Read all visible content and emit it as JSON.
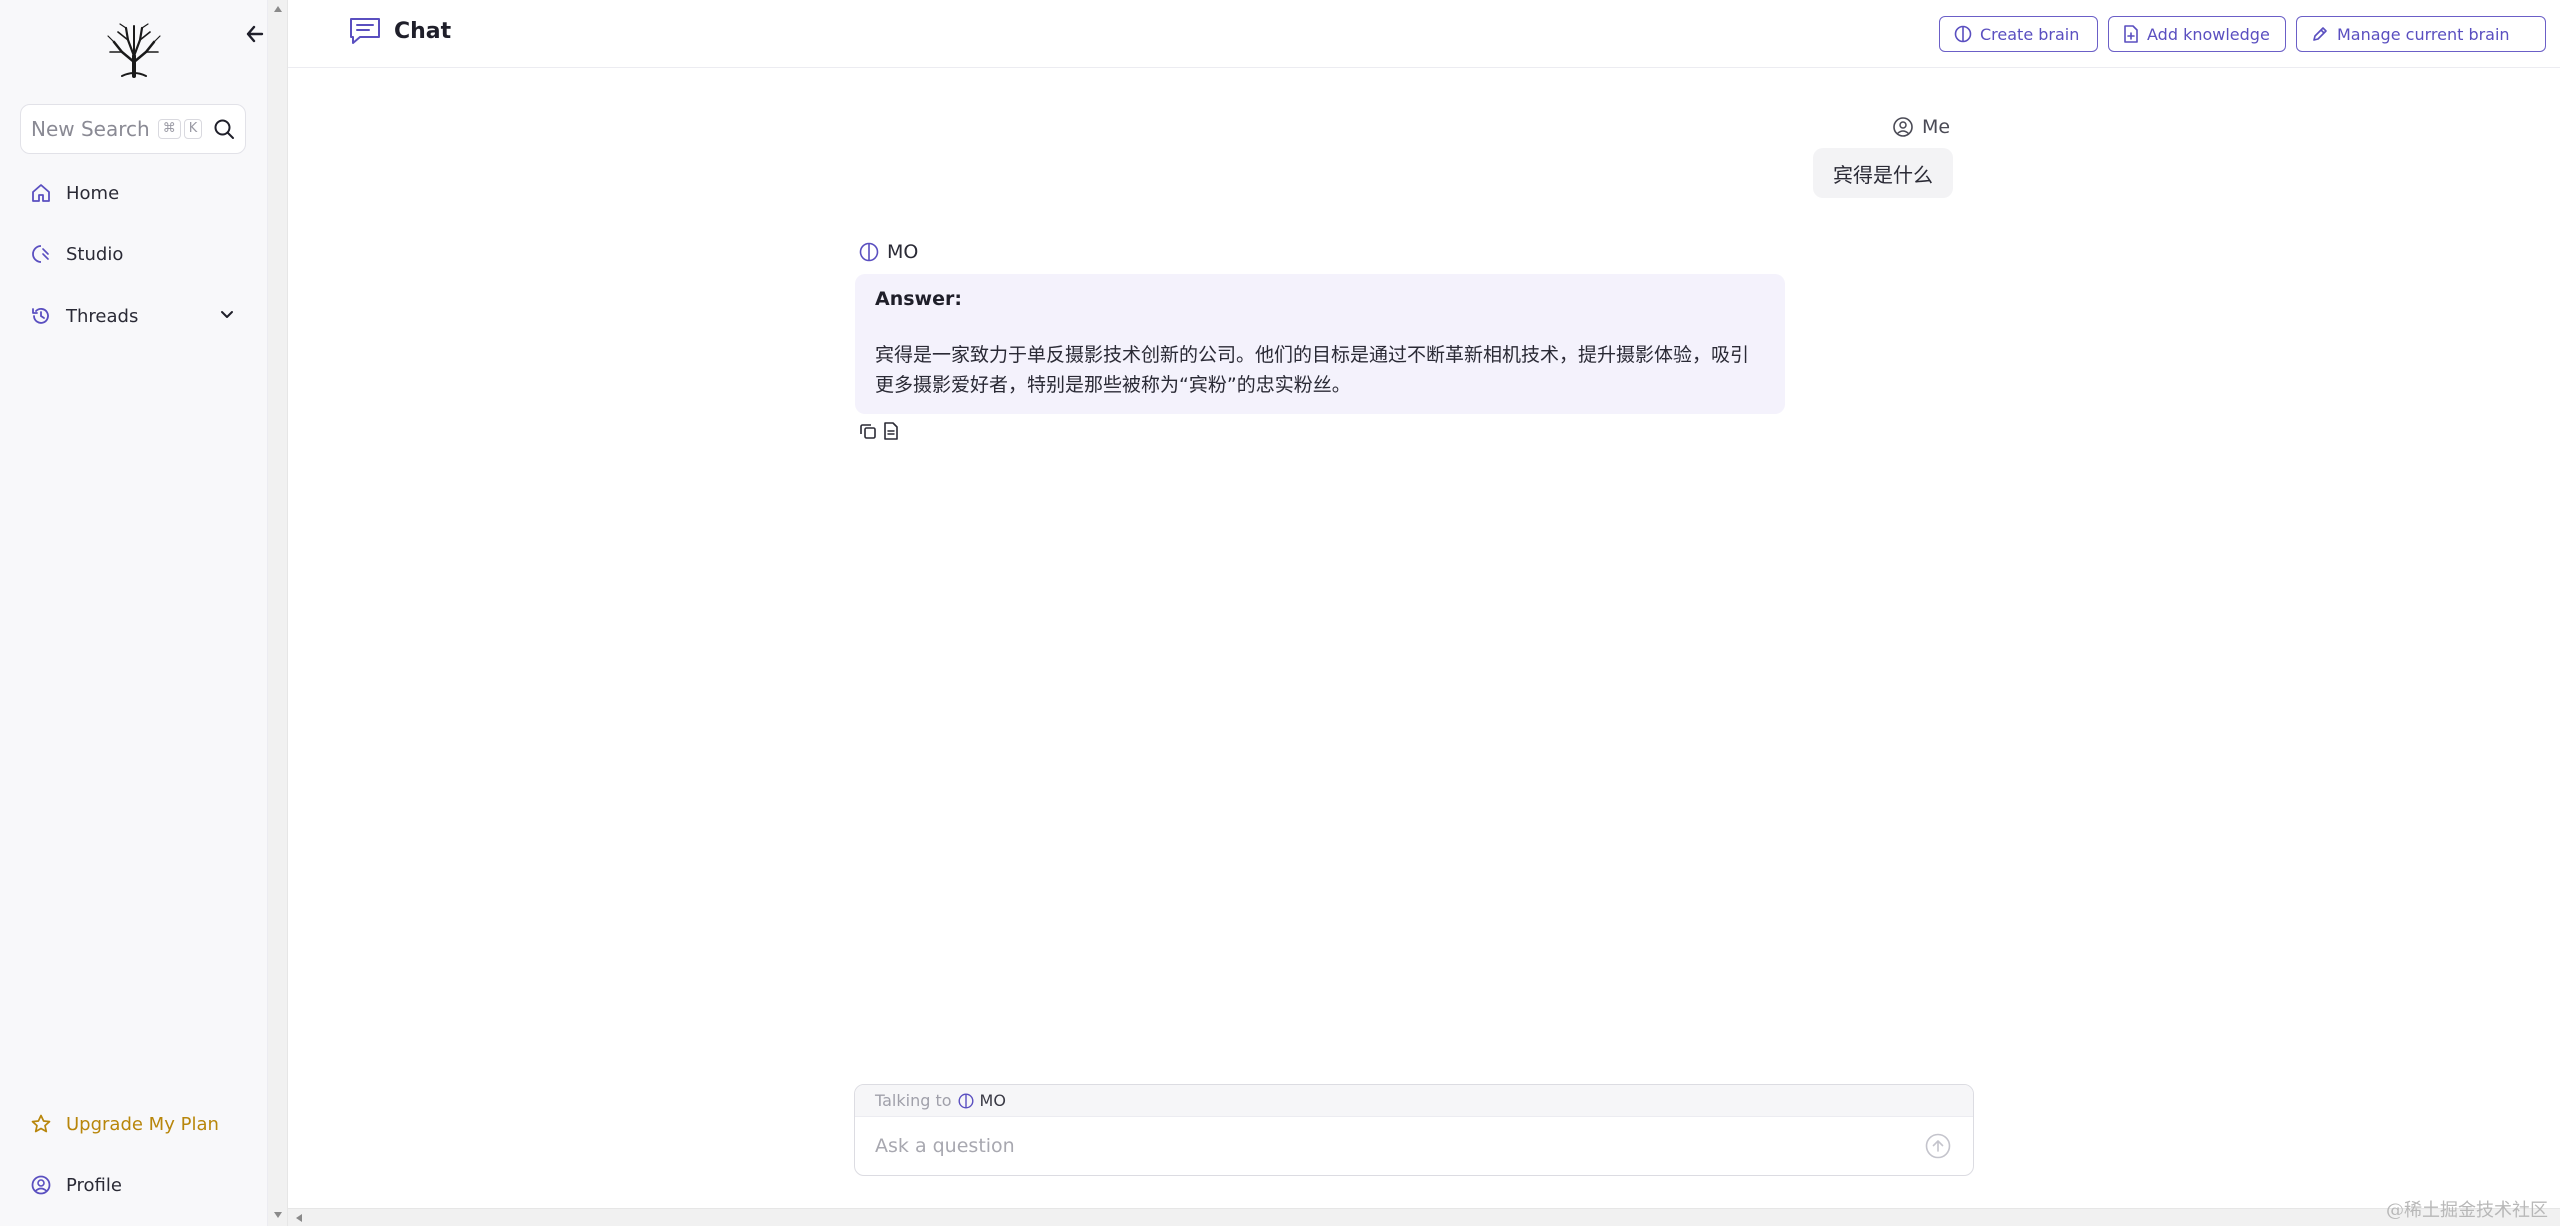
{
  "sidebar": {
    "search_label": "New Search",
    "search_shortcut_cmd": "⌘",
    "search_shortcut_key": "K",
    "nav": {
      "home": "Home",
      "studio": "Studio",
      "threads": "Threads",
      "upgrade": "Upgrade My Plan",
      "profile": "Profile"
    }
  },
  "header": {
    "title": "Chat",
    "create_brain": "Create brain",
    "add_knowledge": "Add knowledge",
    "manage_brain": "Manage current brain"
  },
  "messages": {
    "user_name": "Me",
    "user_text": "宾得是什么",
    "bot_name": "MO",
    "answer_label": "Answer:",
    "answer_text": "宾得是一家致力于单反摄影技术创新的公司。他们的目标是通过不断革新相机技术，提升摄影体验，吸引更多摄影爱好者，特别是那些被称为“宾粉”的忠实粉丝。"
  },
  "input": {
    "talking_to_label": "Talking to",
    "brain_name": "MO",
    "placeholder": "Ask a question"
  },
  "watermark": "@稀土掘金技术社区",
  "colors": {
    "accent": "#5a4fc0",
    "upgrade": "#b8860b",
    "answer_bg": "#f4f2fc"
  }
}
